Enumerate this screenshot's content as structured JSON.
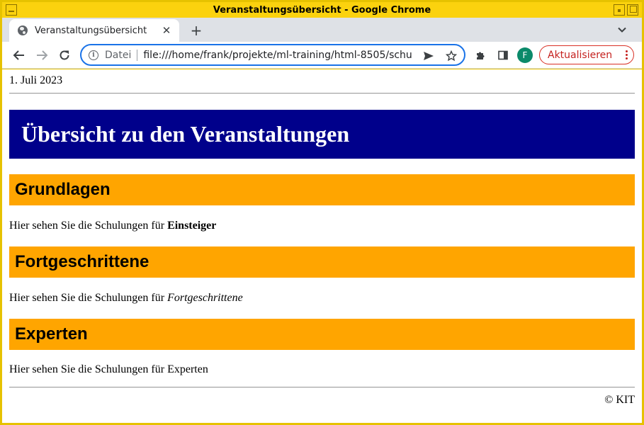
{
  "window": {
    "title": "Veranstaltungsübersicht - Google Chrome"
  },
  "browser": {
    "tab_title": "Veranstaltungsübersicht",
    "new_tab_symbol": "+",
    "close_symbol": "✕",
    "omnibox": {
      "security_label": "Datei",
      "url": "file:///home/frank/projekte/ml-training/html-8505/schu"
    },
    "profile_initial": "F",
    "update_label": "Aktualisieren",
    "accent_color": "#1a73e8",
    "update_color": "#c5221f"
  },
  "page": {
    "date": "1. Juli 2023",
    "banner_title": "Übersicht zu den Veranstaltungen",
    "banner_color": "#00008b",
    "section_color": "#ffa500",
    "sections": [
      {
        "heading": "Grundlagen",
        "text_prefix": "Hier sehen Sie die Schulungen für ",
        "emphasis": "Einsteiger",
        "emphasis_style": "bold"
      },
      {
        "heading": "Fortgeschrittene",
        "text_prefix": "Hier sehen Sie die Schulungen für ",
        "emphasis": "Fortgeschrittene",
        "emphasis_style": "italic"
      },
      {
        "heading": "Experten",
        "text_prefix": "Hier sehen Sie die Schulungen für ",
        "emphasis": "Experten",
        "emphasis_style": "normal"
      }
    ],
    "footer": "© KIT"
  }
}
